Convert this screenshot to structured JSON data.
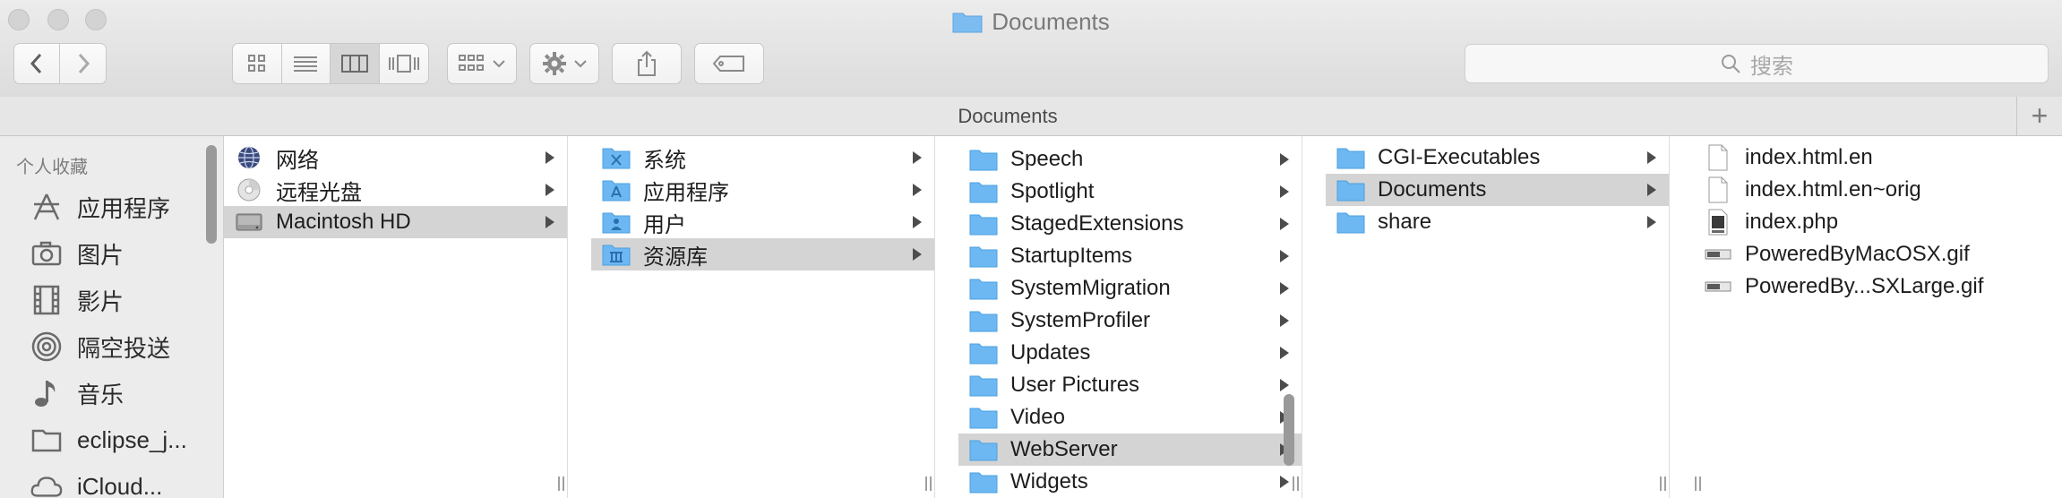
{
  "window": {
    "title": "Documents"
  },
  "toolbar": {
    "back_icon": "chevron-left-icon",
    "forward_icon": "chevron-right-icon",
    "view_modes": [
      "icon-view-icon",
      "list-view-icon",
      "column-view-icon",
      "gallery-view-icon"
    ],
    "active_view": "column-view-icon",
    "search_placeholder": "搜索"
  },
  "pathbar": {
    "title": "Documents",
    "add_label": "+"
  },
  "sidebar": {
    "section_title": "个人收藏",
    "items": [
      {
        "label": "应用程序",
        "icon": "applications-icon"
      },
      {
        "label": "图片",
        "icon": "camera-icon"
      },
      {
        "label": "影片",
        "icon": "film-icon"
      },
      {
        "label": "隔空投送",
        "icon": "airdrop-icon"
      },
      {
        "label": "音乐",
        "icon": "music-note-icon"
      },
      {
        "label": "eclipse_j...",
        "icon": "folder-icon"
      },
      {
        "label": "iCloud...",
        "icon": "icloud-icon"
      }
    ]
  },
  "columns": [
    {
      "items": [
        {
          "label": "网络",
          "icon": "network-globe-icon",
          "arrow": true,
          "selected": false
        },
        {
          "label": "远程光盘",
          "icon": "optical-disc-icon",
          "arrow": true,
          "selected": false
        },
        {
          "label": "Macintosh HD",
          "icon": "hard-drive-icon",
          "arrow": true,
          "selected": true
        }
      ]
    },
    {
      "items": [
        {
          "label": "系统",
          "icon": "system-folder-icon",
          "arrow": true,
          "selected": false
        },
        {
          "label": "应用程序",
          "icon": "applications-folder-icon",
          "arrow": true,
          "selected": false
        },
        {
          "label": "用户",
          "icon": "users-folder-icon",
          "arrow": true,
          "selected": false
        },
        {
          "label": "资源库",
          "icon": "library-folder-icon",
          "arrow": true,
          "selected": true
        }
      ]
    },
    {
      "items": [
        {
          "label": "Speech",
          "icon": "folder-icon",
          "arrow": true,
          "selected": false
        },
        {
          "label": "Spotlight",
          "icon": "folder-icon",
          "arrow": true,
          "selected": false
        },
        {
          "label": "StagedExtensions",
          "icon": "folder-icon",
          "arrow": true,
          "selected": false
        },
        {
          "label": "StartupItems",
          "icon": "folder-icon",
          "arrow": true,
          "selected": false
        },
        {
          "label": "SystemMigration",
          "icon": "folder-icon",
          "arrow": true,
          "selected": false
        },
        {
          "label": "SystemProfiler",
          "icon": "folder-icon",
          "arrow": true,
          "selected": false
        },
        {
          "label": "Updates",
          "icon": "folder-icon",
          "arrow": true,
          "selected": false
        },
        {
          "label": "User Pictures",
          "icon": "folder-icon",
          "arrow": true,
          "selected": false
        },
        {
          "label": "Video",
          "icon": "folder-icon",
          "arrow": true,
          "selected": false
        },
        {
          "label": "WebServer",
          "icon": "folder-icon",
          "arrow": true,
          "selected": true
        },
        {
          "label": "Widgets",
          "icon": "folder-icon",
          "arrow": true,
          "selected": false
        }
      ]
    },
    {
      "items": [
        {
          "label": "CGI-Executables",
          "icon": "folder-icon",
          "arrow": true,
          "selected": false
        },
        {
          "label": "Documents",
          "icon": "folder-icon",
          "arrow": true,
          "selected": true
        },
        {
          "label": "share",
          "icon": "folder-icon",
          "arrow": true,
          "selected": false
        }
      ]
    },
    {
      "items": [
        {
          "label": "index.html.en",
          "icon": "document-icon",
          "arrow": false,
          "selected": false
        },
        {
          "label": "index.html.en~orig",
          "icon": "document-icon",
          "arrow": false,
          "selected": false
        },
        {
          "label": "index.php",
          "icon": "php-file-icon",
          "arrow": false,
          "selected": false
        },
        {
          "label": "PoweredByMacOSX.gif",
          "icon": "gif-image-icon",
          "arrow": false,
          "selected": false
        },
        {
          "label": "PoweredBy...SXLarge.gif",
          "icon": "gif-image-icon",
          "arrow": false,
          "selected": false
        }
      ]
    }
  ],
  "colors": {
    "folder_blue": "#5fb3ef",
    "selection_gray": "#d4d4d4",
    "toolbar_bg": "#e4e4e4"
  }
}
